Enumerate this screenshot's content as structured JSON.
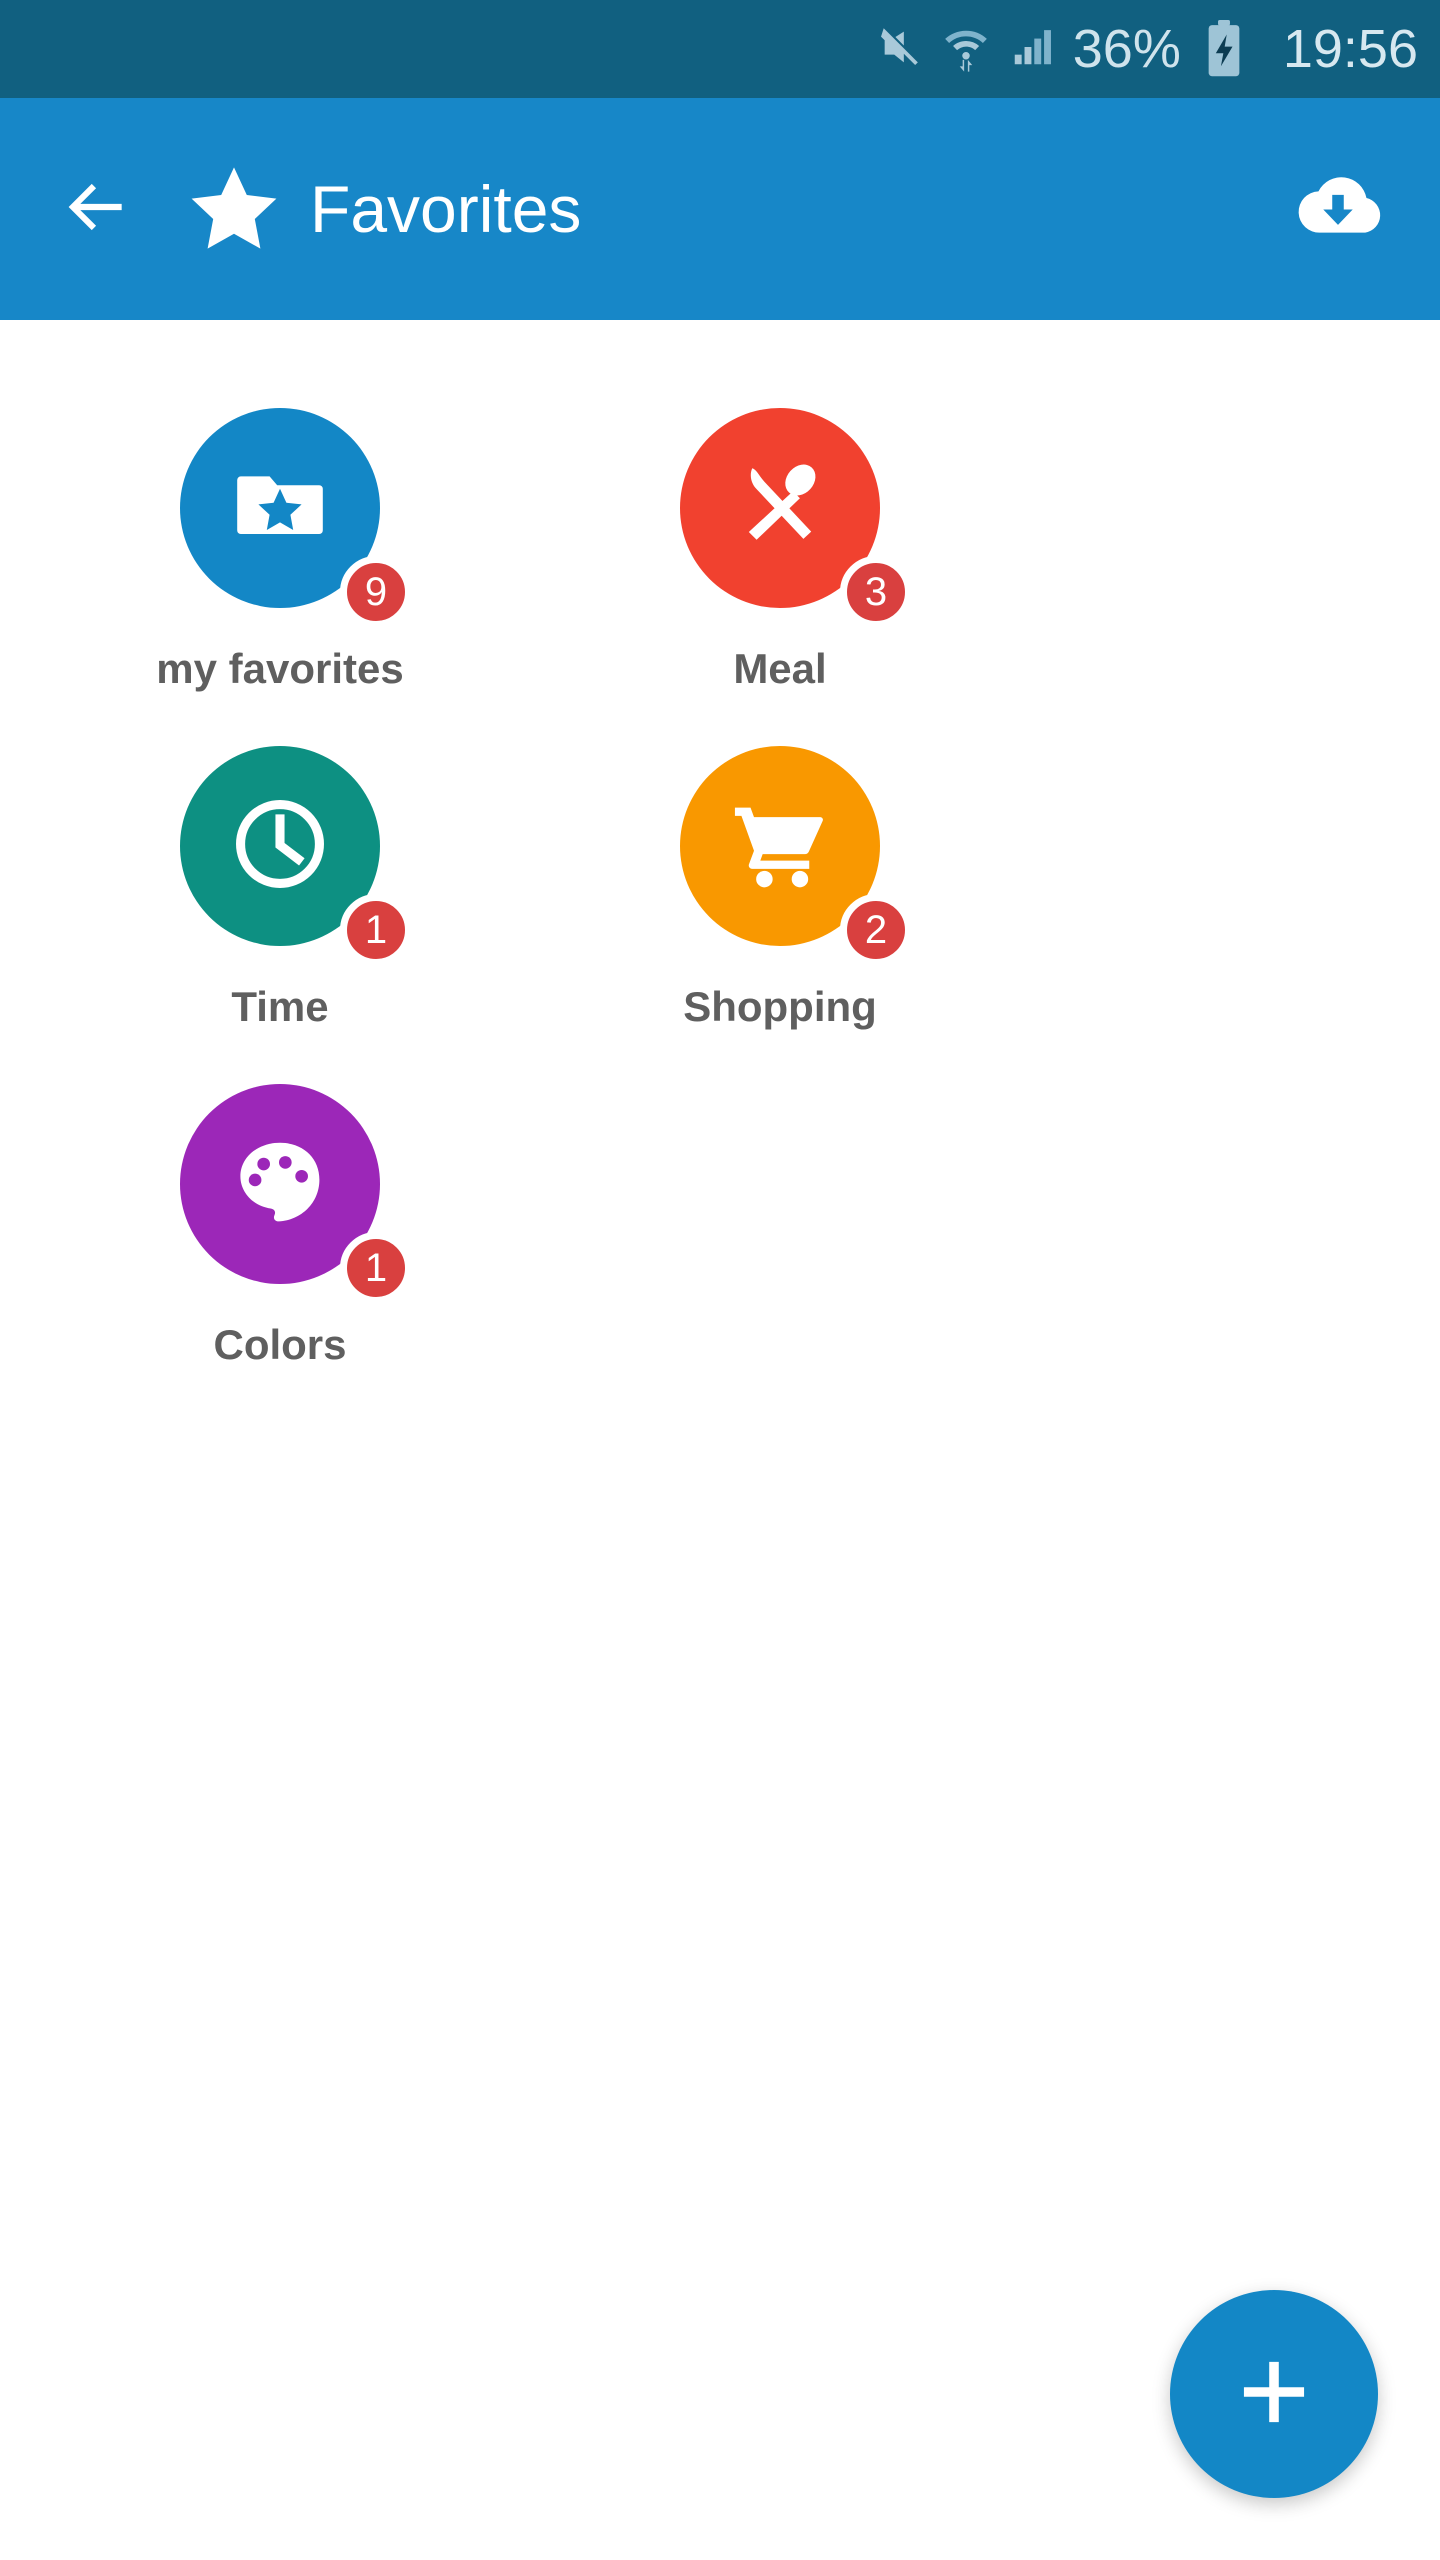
{
  "status_bar": {
    "background_color": "#116080",
    "text_color": "#cfe3ec",
    "icons": [
      "mute-icon",
      "wifi-icon",
      "signal-icon",
      "battery-charging-icon"
    ],
    "battery_percent": "36%",
    "clock": "19:56"
  },
  "app_bar": {
    "background_color": "#1787c8",
    "back_icon": "back-arrow-icon",
    "brand_icon": "star-icon",
    "title": "Favorites",
    "action_icon": "cloud-download-icon"
  },
  "grid": {
    "label_color": "#5f5f5f",
    "badge_color": "#d9403f",
    "items": [
      {
        "label": "my favorites",
        "badge": "9",
        "color": "#1387c6",
        "icon": "folder-star-icon"
      },
      {
        "label": "Meal",
        "badge": "3",
        "color": "#f1412f",
        "icon": "knife-spoon-icon"
      },
      {
        "label": "Time",
        "badge": "1",
        "color": "#0d9082",
        "icon": "clock-icon"
      },
      {
        "label": "Shopping",
        "badge": "2",
        "color": "#f99800",
        "icon": "shopping-cart-icon"
      },
      {
        "label": "Colors",
        "badge": "1",
        "color": "#9c27b8",
        "icon": "palette-icon"
      }
    ]
  },
  "fab": {
    "icon": "plus-icon",
    "color": "#1387c6"
  }
}
